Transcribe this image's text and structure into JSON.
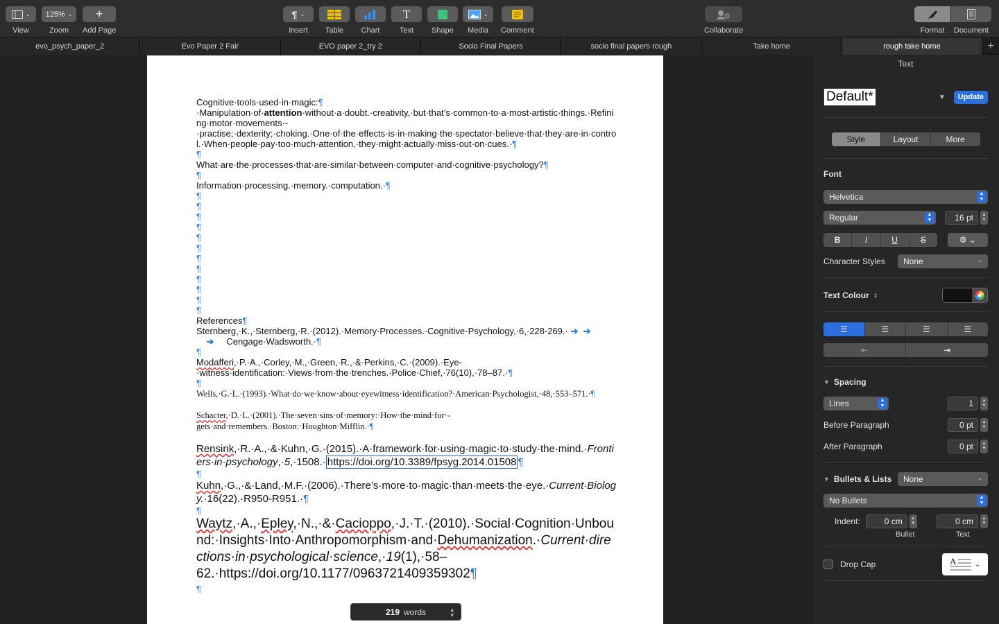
{
  "toolbar": {
    "view": "View",
    "zoom": "Zoom",
    "zoom_value": "125%",
    "add_page": "Add Page",
    "insert": "Insert",
    "table": "Table",
    "chart": "Chart",
    "text": "Text",
    "shape": "Shape",
    "media": "Media",
    "comment": "Comment",
    "collaborate": "Collaborate",
    "format": "Format",
    "document": "Document"
  },
  "tabs": [
    "evo_psych_paper_2",
    "Evo Paper 2 Fair",
    "EVO paper 2_try 2",
    "Socio Final Papers",
    "socio final papers rough",
    "Take home",
    "rough take home"
  ],
  "doc": {
    "l1": "Cognitive·tools·used·in·magic:",
    "l2a": "·Manipulation·of·",
    "l2b": "attention",
    "l2c": "·without·a·doubt.·creativity,·but·that’s·common·to·a·most·artistic·things.·Refining·motor·movements·-·practise;·dexterity;·choking.·One·of·the·effects·is·in·making·the·spectator·believe·that·they·are·in·control.·When·people·pay·too·much·attention,·they·might·actually·miss·out·on·cues.·",
    "q": "What·are·the·processes·that·are·similar·between·computer·and·cognitive·psychology?",
    "a": "Information·processing.·memory.·computation.·",
    "refs": "References",
    "r1": "Sternberg,·K.,·Sternberg,·R.·(2012).·Memory·Processes.·Cognitive·Psychology,·6,·228-269.·",
    "r1b": "Cengage·Wadsworth.·",
    "r2a": "Modafferi",
    "r2b": ",·P.·A.,·Corley,·M.,·Green,·R.,·&·Perkins,·C.·(2009).·Eye-·witness·identification:·Views·from·the·trenches.·Police·Chief,·76(10),·78–87.·",
    "r3": "Wells,·G.·L.·(1993).·What·do·we·know·about·eyewitness·identification?·American·Psychologist,·48,·553–571.·",
    "r4a": "Schacter",
    "r4b": ",·D.·L.·(2001).·The·seven·sins·of·memory:·How·the·mind·for·-gets·and·remembers.·Boston:·Houghton·Mifflin.·",
    "r5a": "Rensink",
    "r5b": ",·R.·A.,·&·Kuhn,·G.·(2015).·A·framework·for·using·magic·to·study·the·mind.·",
    "r5c": "Frontiers·in·psychology",
    "r5d": ",·",
    "r5e": "5",
    "r5f": ",·1508.·",
    "r5link": "https://doi.org/10.3389/fpsyg.2014.01508",
    "r6a": "Kuhn",
    "r6b": ",·G.,·&·Land,·M.F.·(2006).·There’s·more·to·magic·than·meets·the·eye.·",
    "r6c": "Current·Biology.",
    "r6d": "·16(22).·R950-R951.·",
    "r7a": "Waytz",
    "r7b": ",·A.,·",
    "r7c": "Epley",
    "r7d": ",·N.,·&·",
    "r7e": "Cacioppo",
    "r7f": ",·J.·T.·(2010).·Social·Cognition·Unbound:·Insights·Into·Anthropomorphism·and·",
    "r7g": "Dehumanization",
    "r7h": ".·",
    "r7i": "Current·directions·in·psychological·science",
    "r7j": ",·",
    "r7k": "19",
    "r7l": "(1),·58–62.·https://doi.org/10.1177/0963721409359302",
    "pilcrow": "¶"
  },
  "wordcount": {
    "count": "219",
    "label": "words"
  },
  "inspector": {
    "title": "Text",
    "style_name": "Default*",
    "update": "Update",
    "tabs": [
      "Style",
      "Layout",
      "More"
    ],
    "font_label": "Font",
    "font_family": "Helvetica",
    "font_weight": "Regular",
    "font_size": "16 pt",
    "char_styles_label": "Character Styles",
    "char_styles_value": "None",
    "text_colour_label": "Text Colour",
    "spacing_label": "Spacing",
    "spacing_mode": "Lines",
    "spacing_value": "1",
    "before_label": "Before Paragraph",
    "before_value": "0 pt",
    "after_label": "After Paragraph",
    "after_value": "0 pt",
    "bullets_label": "Bullets & Lists",
    "bullets_value": "None",
    "bullets_type": "No Bullets",
    "indent_label": "Indent:",
    "indent_bullet": "0 cm",
    "indent_text": "0 cm",
    "bullet_caption": "Bullet",
    "text_caption": "Text",
    "drop_cap": "Drop Cap"
  }
}
